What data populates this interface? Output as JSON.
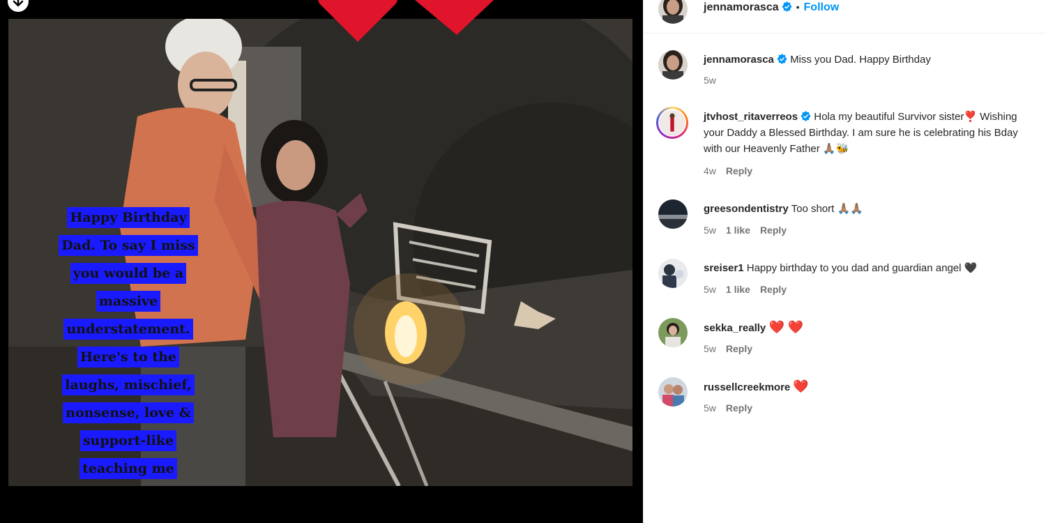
{
  "post": {
    "story_text": "Happy Birthday Dad. To say I miss you would be a massive understatement. Here's to the laughs, mischief, nonsense, love & support-like teaching me"
  },
  "header": {
    "username": "jennamorasca",
    "separator": "•",
    "follow_label": "Follow"
  },
  "comments": [
    {
      "username": "jennamorasca",
      "verified": true,
      "text": "Miss you Dad. Happy Birthday",
      "time": "5w",
      "likes": "",
      "reply": ""
    },
    {
      "username": "jtvhost_ritaverreos",
      "verified": true,
      "text": "Hola my beautiful Survivor sister❣️ Wishing your Daddy a Blessed Birthday. I am sure he is celebrating his Bday with our Heavenly Father 🙏🏽🐝",
      "time": "4w",
      "likes": "",
      "reply": "Reply"
    },
    {
      "username": "greesondentistry",
      "verified": false,
      "text": "Too short 🙏🏽🙏🏽",
      "time": "5w",
      "likes": "1 like",
      "reply": "Reply"
    },
    {
      "username": "sreiser1",
      "verified": false,
      "text": "Happy birthday to you dad and guardian angel 🖤",
      "time": "5w",
      "likes": "1 like",
      "reply": "Reply"
    },
    {
      "username": "sekka_really",
      "verified": false,
      "text": "❤️ ❤️",
      "time": "5w",
      "likes": "",
      "reply": "Reply"
    },
    {
      "username": "russellcreekmore",
      "verified": false,
      "text": "❤️",
      "time": "5w",
      "likes": "",
      "reply": "Reply"
    }
  ],
  "colors": {
    "accent": "#0095f6",
    "verified": "#0095f6",
    "text_box": "#1a1aff",
    "heart": "#e0142a"
  },
  "icons": [
    "download-icon",
    "heart-icon",
    "verified-badge-icon"
  ]
}
